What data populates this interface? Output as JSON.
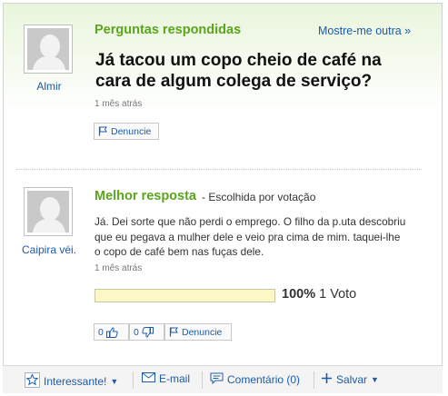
{
  "question": {
    "section_title": "Perguntas respondidas",
    "more_link": "Mostre-me outra »",
    "asker": "Almir",
    "text": "Já tacou um copo cheio de café na cara de algum colega de serviço?",
    "time": "1 mês atrás",
    "report_label": "Denuncie"
  },
  "best_answer": {
    "title": "Melhor resposta",
    "chosen_by": "- Escolhida por votação",
    "answerer": "Caipira véi.",
    "text": "Já. Dei sorte que não perdi o emprego. O filho da p.uta descobriu que eu pegava a mulher dele e veio pra cima de mim. taquei-lhe o copo de café bem nas fuças dele.",
    "time": "1 mês atrás",
    "vote_percent_label": "100%",
    "vote_fraction": 1.0,
    "vote_count_label": "1 Voto",
    "thumbs_up_count": "0",
    "thumbs_down_count": "0",
    "report_label": "Denuncie"
  },
  "footer": {
    "interesting_label": "Interessante!",
    "email_label": "E-mail",
    "comment_label": "Comentário (0)",
    "save_label": "Salvar"
  },
  "colors": {
    "accent_green": "#5aa51c",
    "link_blue": "#1d5aa9",
    "vote_bar": "#fbf8c6"
  }
}
